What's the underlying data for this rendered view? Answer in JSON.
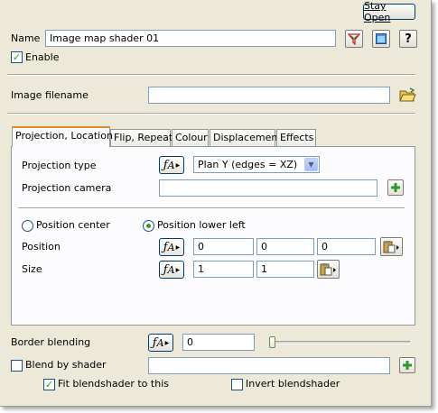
{
  "stay_open_label": "Stay Open",
  "name": {
    "label": "Name",
    "value": "Image map shader 01"
  },
  "enable": {
    "label": "Enable",
    "checked": true
  },
  "image_filename": {
    "label": "Image filename",
    "value": ""
  },
  "tabs": [
    {
      "label": "Projection, Location",
      "active": true
    },
    {
      "label": "Flip, Repeat",
      "active": false
    },
    {
      "label": "Colour",
      "active": false
    },
    {
      "label": "Displacement",
      "active": false
    },
    {
      "label": "Effects",
      "active": false
    }
  ],
  "projection": {
    "type_label": "Projection type",
    "type_value": "Plan Y (edges = XZ)",
    "camera_label": "Projection camera",
    "camera_value": ""
  },
  "position_mode": {
    "center_label": "Position center",
    "lower_left_label": "Position lower left",
    "selected": "lower_left"
  },
  "position": {
    "label": "Position",
    "x": "0",
    "y": "0",
    "z": "0"
  },
  "size": {
    "label": "Size",
    "x": "1",
    "y": "1"
  },
  "border_blending": {
    "label": "Border blending",
    "value": "0",
    "slider_fraction": 0
  },
  "blend_by_shader": {
    "label": "Blend by shader",
    "checked": false,
    "value": ""
  },
  "fit_blendshader": {
    "label": "Fit blendshader to this",
    "checked": true
  },
  "invert_blendshader": {
    "label": "Invert blendshader",
    "checked": false
  },
  "colors": {
    "tab_active_accent": "#e68b2c",
    "check_green": "#21a121",
    "add_green": "#2e9a2e"
  },
  "icons": {
    "name_filter": "funnel-icon",
    "preview": "window-icon",
    "help": "question-icon",
    "browse": "open-folder-icon",
    "fx": "function-icon",
    "add": "plus-icon",
    "pick": "paste-icon"
  }
}
